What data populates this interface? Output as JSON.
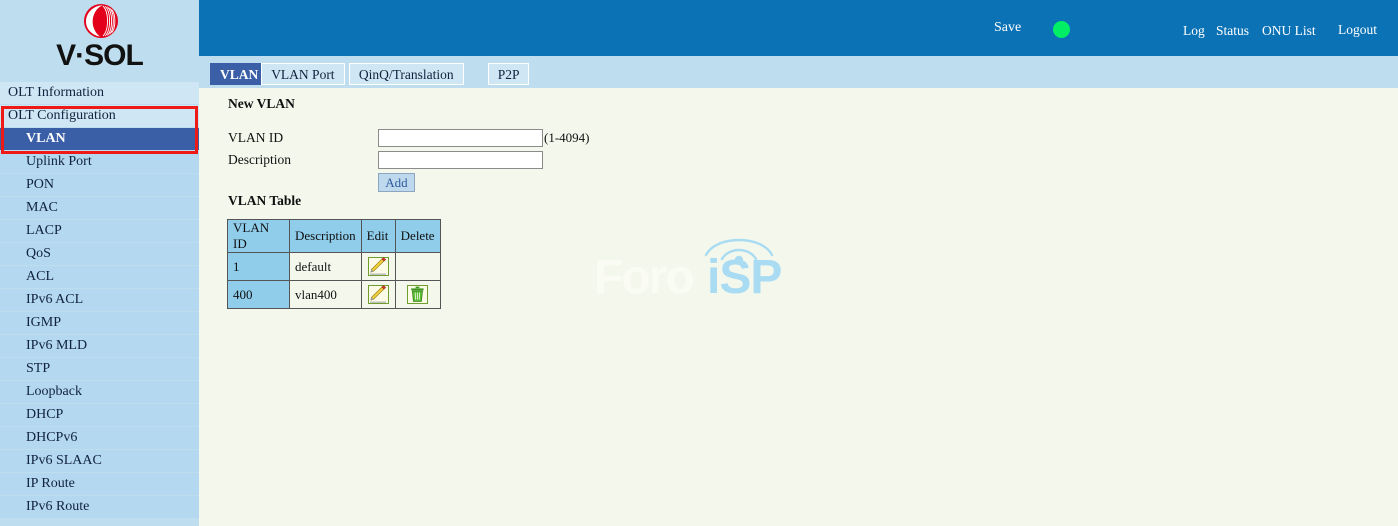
{
  "brand": {
    "logo_text": "V·SOL",
    "logo_mark": "vsol-globe-icon"
  },
  "header": {
    "save_label": "Save",
    "status_indicator": "green-status-dot",
    "status_color": "#00ee66",
    "links": [
      {
        "label": "Log"
      },
      {
        "label": "Status"
      },
      {
        "label": "ONU List"
      },
      {
        "label": "Logout"
      }
    ]
  },
  "sidebar": {
    "items": [
      {
        "label": "OLT Information",
        "level": "top",
        "selected": false
      },
      {
        "label": "OLT Configuration",
        "level": "top",
        "selected": false
      },
      {
        "label": "VLAN",
        "level": "sub",
        "selected": true
      },
      {
        "label": "Uplink Port",
        "level": "sub",
        "selected": false
      },
      {
        "label": "PON",
        "level": "sub",
        "selected": false
      },
      {
        "label": "MAC",
        "level": "sub",
        "selected": false
      },
      {
        "label": "LACP",
        "level": "sub",
        "selected": false
      },
      {
        "label": "QoS",
        "level": "sub",
        "selected": false
      },
      {
        "label": "ACL",
        "level": "sub",
        "selected": false
      },
      {
        "label": "IPv6 ACL",
        "level": "sub",
        "selected": false
      },
      {
        "label": "IGMP",
        "level": "sub",
        "selected": false
      },
      {
        "label": "IPv6 MLD",
        "level": "sub",
        "selected": false
      },
      {
        "label": "STP",
        "level": "sub",
        "selected": false
      },
      {
        "label": "Loopback",
        "level": "sub",
        "selected": false
      },
      {
        "label": "DHCP",
        "level": "sub",
        "selected": false
      },
      {
        "label": "DHCPv6",
        "level": "sub",
        "selected": false
      },
      {
        "label": "IPv6 SLAAC",
        "level": "sub",
        "selected": false
      },
      {
        "label": "IP Route",
        "level": "sub",
        "selected": false
      },
      {
        "label": "IPv6 Route",
        "level": "sub",
        "selected": false
      }
    ],
    "highlight_color": "#ef1a16",
    "selected_color": "#3a5fa6"
  },
  "tabs": [
    {
      "label": "VLAN",
      "active": true
    },
    {
      "label": "VLAN Port",
      "active": false
    },
    {
      "label": "QinQ/Translation",
      "active": false
    },
    {
      "label": "P2P",
      "active": false
    }
  ],
  "main": {
    "new_vlan_title": "New VLAN",
    "vlan_id_label": "VLAN ID",
    "vlan_id_value": "",
    "vlan_id_range_hint": "(1-4094)",
    "description_label": "Description",
    "description_value": "",
    "add_button_label": "Add",
    "vlan_table_title": "VLAN Table",
    "table": {
      "columns": [
        "VLAN ID",
        "Description",
        "Edit",
        "Delete"
      ],
      "rows": [
        {
          "vlan_id": "1",
          "description": "default",
          "edit_icon": "edit-pencil-icon",
          "delete_icon": ""
        },
        {
          "vlan_id": "400",
          "description": "vlan400",
          "edit_icon": "edit-pencil-icon",
          "delete_icon": "trash-can-icon"
        }
      ]
    }
  },
  "watermark": {
    "text_light": "Foro",
    "text_accent": "iSP",
    "accent_color": "#a9dbf2"
  }
}
